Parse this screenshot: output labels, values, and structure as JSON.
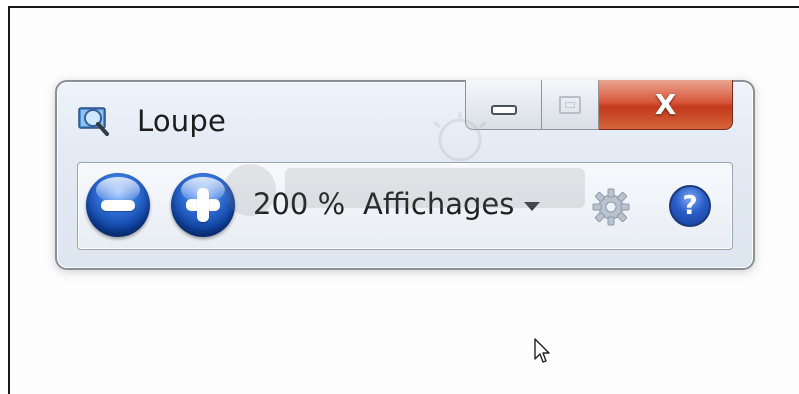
{
  "window": {
    "title": "Loupe",
    "icon": "magnifier-app-icon"
  },
  "caption_buttons": {
    "minimize": "minimize-icon",
    "maximize": "maximize-icon",
    "close_label": "X"
  },
  "toolbar": {
    "zoom_out_icon": "minus-icon",
    "zoom_in_icon": "plus-icon",
    "zoom_level": "200 %",
    "views_label": "Affichages",
    "views_icon": "chevron-down-icon",
    "settings_icon": "gear-icon",
    "help_label": "?"
  },
  "colors": {
    "close_button": "#d4503a",
    "round_button_blue": "#1e55c2",
    "window_background": "#e6ecf5"
  }
}
